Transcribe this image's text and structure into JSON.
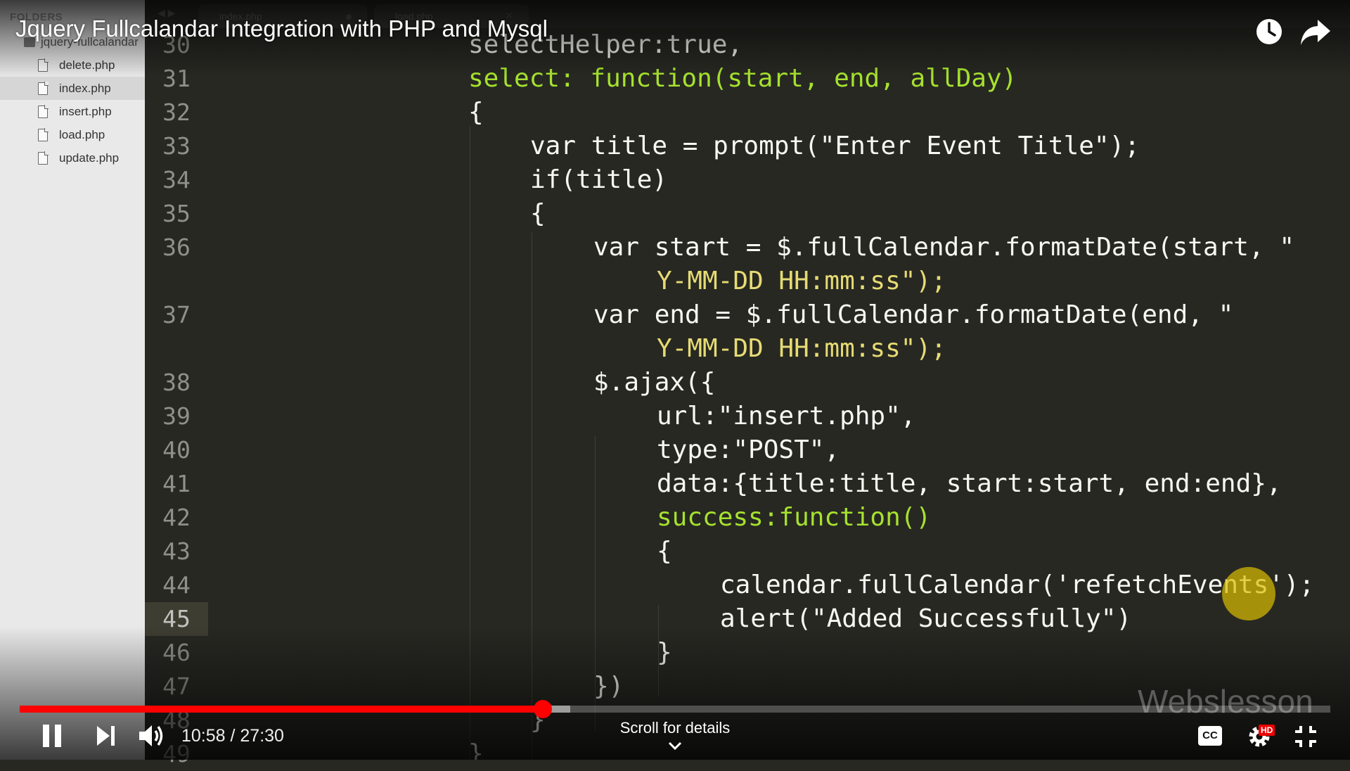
{
  "window": {
    "title": "Jquery Fullcalandar Integration with PHP and Mysql"
  },
  "sidebar": {
    "header": "FOLDERS",
    "project": "jquery-fullcalandar",
    "files": [
      {
        "name": "delete.php",
        "active": false
      },
      {
        "name": "index.php",
        "active": true
      },
      {
        "name": "insert.php",
        "active": false
      },
      {
        "name": "load.php",
        "active": false
      },
      {
        "name": "update.php",
        "active": false
      }
    ]
  },
  "tabs": [
    {
      "label": "index.php",
      "modified": true
    },
    {
      "label": "load.php",
      "modified": false
    }
  ],
  "editor": {
    "current_line": "45",
    "line_numbers": [
      "30",
      "31",
      "32",
      "33",
      "34",
      "35",
      "36",
      "",
      "37",
      "",
      "38",
      "39",
      "40",
      "41",
      "42",
      "43",
      "44",
      "45",
      "46",
      "47",
      "48",
      "49"
    ],
    "code_lines": [
      "selectHelper:true,",
      "select: function(start, end, allDay)",
      "{",
      "var title = prompt(\"Enter Event Title\");",
      "if(title)",
      "{",
      "var start = $.fullCalendar.formatDate(start, \"",
      "Y-MM-DD HH:mm:ss\");",
      "var end = $.fullCalendar.formatDate(end, \"",
      "Y-MM-DD HH:mm:ss\");",
      "$.ajax({",
      "url:\"insert.php\",",
      "type:\"POST\",",
      "data:{title:title, start:start, end:end},",
      "success:function()",
      "{",
      "calendar.fullCalendar('refetchEvents');",
      "alert(\"Added Successfully\")",
      "}",
      "})",
      "}",
      "}"
    ]
  },
  "player": {
    "time": "10:58 / 27:30",
    "progress_fraction": 0.399,
    "buffered_fraction": 0.42,
    "scroll_hint": "Scroll for details",
    "watermark": "Webslesson",
    "hd_badge": "HD",
    "cc_label": "CC",
    "accent_color": "#ff0000"
  },
  "icons": {
    "watch_later": "clock-icon",
    "share": "share-arrow-icon",
    "pause": "pause-icon",
    "next": "skip-next-icon",
    "volume": "volume-icon",
    "captions": "cc-icon",
    "settings": "gear-icon",
    "exit_fullscreen": "exit-fullscreen-icon",
    "scroll": "chevron-down-icon"
  }
}
